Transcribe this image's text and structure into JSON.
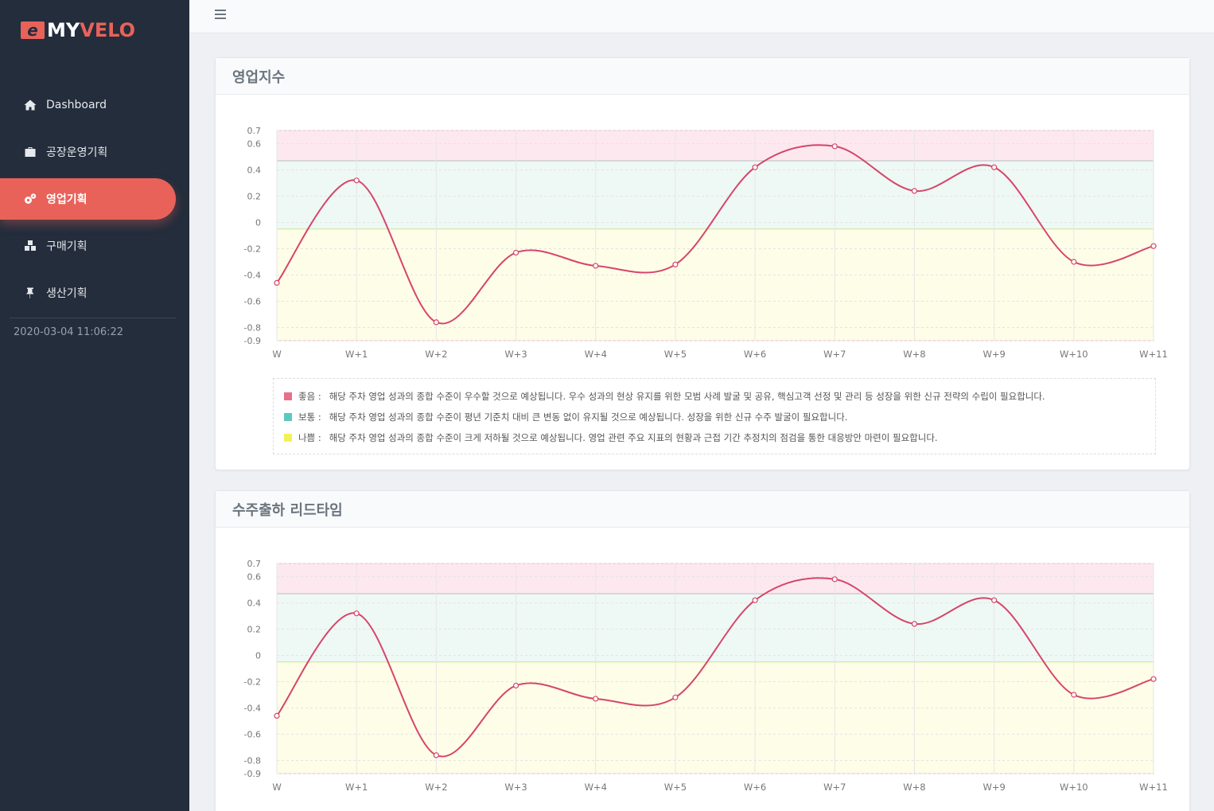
{
  "brand": {
    "prefix": "e",
    "my": "MY",
    "velo": "VELO"
  },
  "nav": [
    {
      "label": "Dashboard",
      "icon": "home-icon",
      "active": false
    },
    {
      "label": "공장운영기획",
      "icon": "briefcase-icon",
      "active": false
    },
    {
      "label": "영업기획",
      "icon": "gears-icon",
      "active": true
    },
    {
      "label": "구매기획",
      "icon": "cubes-icon",
      "active": false
    },
    {
      "label": "생산기획",
      "icon": "pin-icon",
      "active": false
    }
  ],
  "datetime": "2020-03-04 11:06:22",
  "colors": {
    "accent": "#e8625a",
    "sidebar": "#232d3b",
    "line": "#d6456a",
    "good_band": "#fde8f0",
    "normal_band": "#eef8f5",
    "bad_band": "#fefde8",
    "good_swatch": "#e8708a",
    "normal_swatch": "#5bc8c0",
    "bad_swatch": "#f5f05a"
  },
  "cards": [
    {
      "title": "영업지수",
      "legend": [
        {
          "key": "좋음 :",
          "desc": "해당 주차 영업 성과의 종합 수준이 우수할 것으로 예상됩니다. 우수 성과의 현상 유지를 위한 모범 사례 발굴 및 공유, 핵심고객 선정 및 관리 등 성장을 위한 신규 전략의 수립이 필요합니다."
        },
        {
          "key": "보통 :",
          "desc": "해당 주차 영업 성과의 종합 수준이 평년 기준치 대비 큰 변동 없이 유지될 것으로 예상됩니다. 성장을 위한 신규 수주 발굴이 필요합니다."
        },
        {
          "key": "나쁨 :",
          "desc": "해당 주차 영업 성과의 종합 수준이 크게 저하될 것으로 예상됩니다. 영업 관련 주요 지표의 현황과 근접 기간 추정치의 점검을 통한 대응방안 마련이 필요합니다."
        }
      ]
    },
    {
      "title": "수주출하 리드타임"
    }
  ],
  "chart_data": [
    {
      "type": "line",
      "x": [
        "W",
        "W+1",
        "W+2",
        "W+3",
        "W+4",
        "W+5",
        "W+6",
        "W+7",
        "W+8",
        "W+9",
        "W+10",
        "W+11"
      ],
      "values": [
        -0.46,
        0.32,
        -0.76,
        -0.23,
        -0.33,
        -0.32,
        0.42,
        0.58,
        0.24,
        0.42,
        -0.3,
        -0.18
      ],
      "yticks": [
        0.7,
        0.6,
        0.4,
        0.2,
        0,
        -0.2,
        -0.4,
        -0.6,
        -0.8,
        -0.9
      ],
      "ylim": [
        -0.9,
        0.7
      ],
      "bands": [
        {
          "name": "좋음",
          "from": 0.47,
          "to": 0.7
        },
        {
          "name": "보통",
          "from": -0.05,
          "to": 0.47
        },
        {
          "name": "나쁨",
          "from": -0.9,
          "to": -0.05
        }
      ],
      "grid": true
    },
    {
      "type": "line",
      "x": [
        "W",
        "W+1",
        "W+2",
        "W+3",
        "W+4",
        "W+5",
        "W+6",
        "W+7",
        "W+8",
        "W+9",
        "W+10",
        "W+11"
      ],
      "values": [
        -0.46,
        0.32,
        -0.76,
        -0.23,
        -0.33,
        -0.32,
        0.42,
        0.58,
        0.24,
        0.42,
        -0.3,
        -0.18
      ],
      "yticks": [
        0.7,
        0.6,
        0.4,
        0.2,
        0,
        -0.2,
        -0.4,
        -0.6,
        -0.8,
        -0.9
      ],
      "ylim": [
        -0.9,
        0.7
      ],
      "bands": [
        {
          "name": "좋음",
          "from": 0.47,
          "to": 0.7
        },
        {
          "name": "보통",
          "from": -0.05,
          "to": 0.47
        },
        {
          "name": "나쁨",
          "from": -0.9,
          "to": -0.05
        }
      ],
      "grid": true
    }
  ]
}
